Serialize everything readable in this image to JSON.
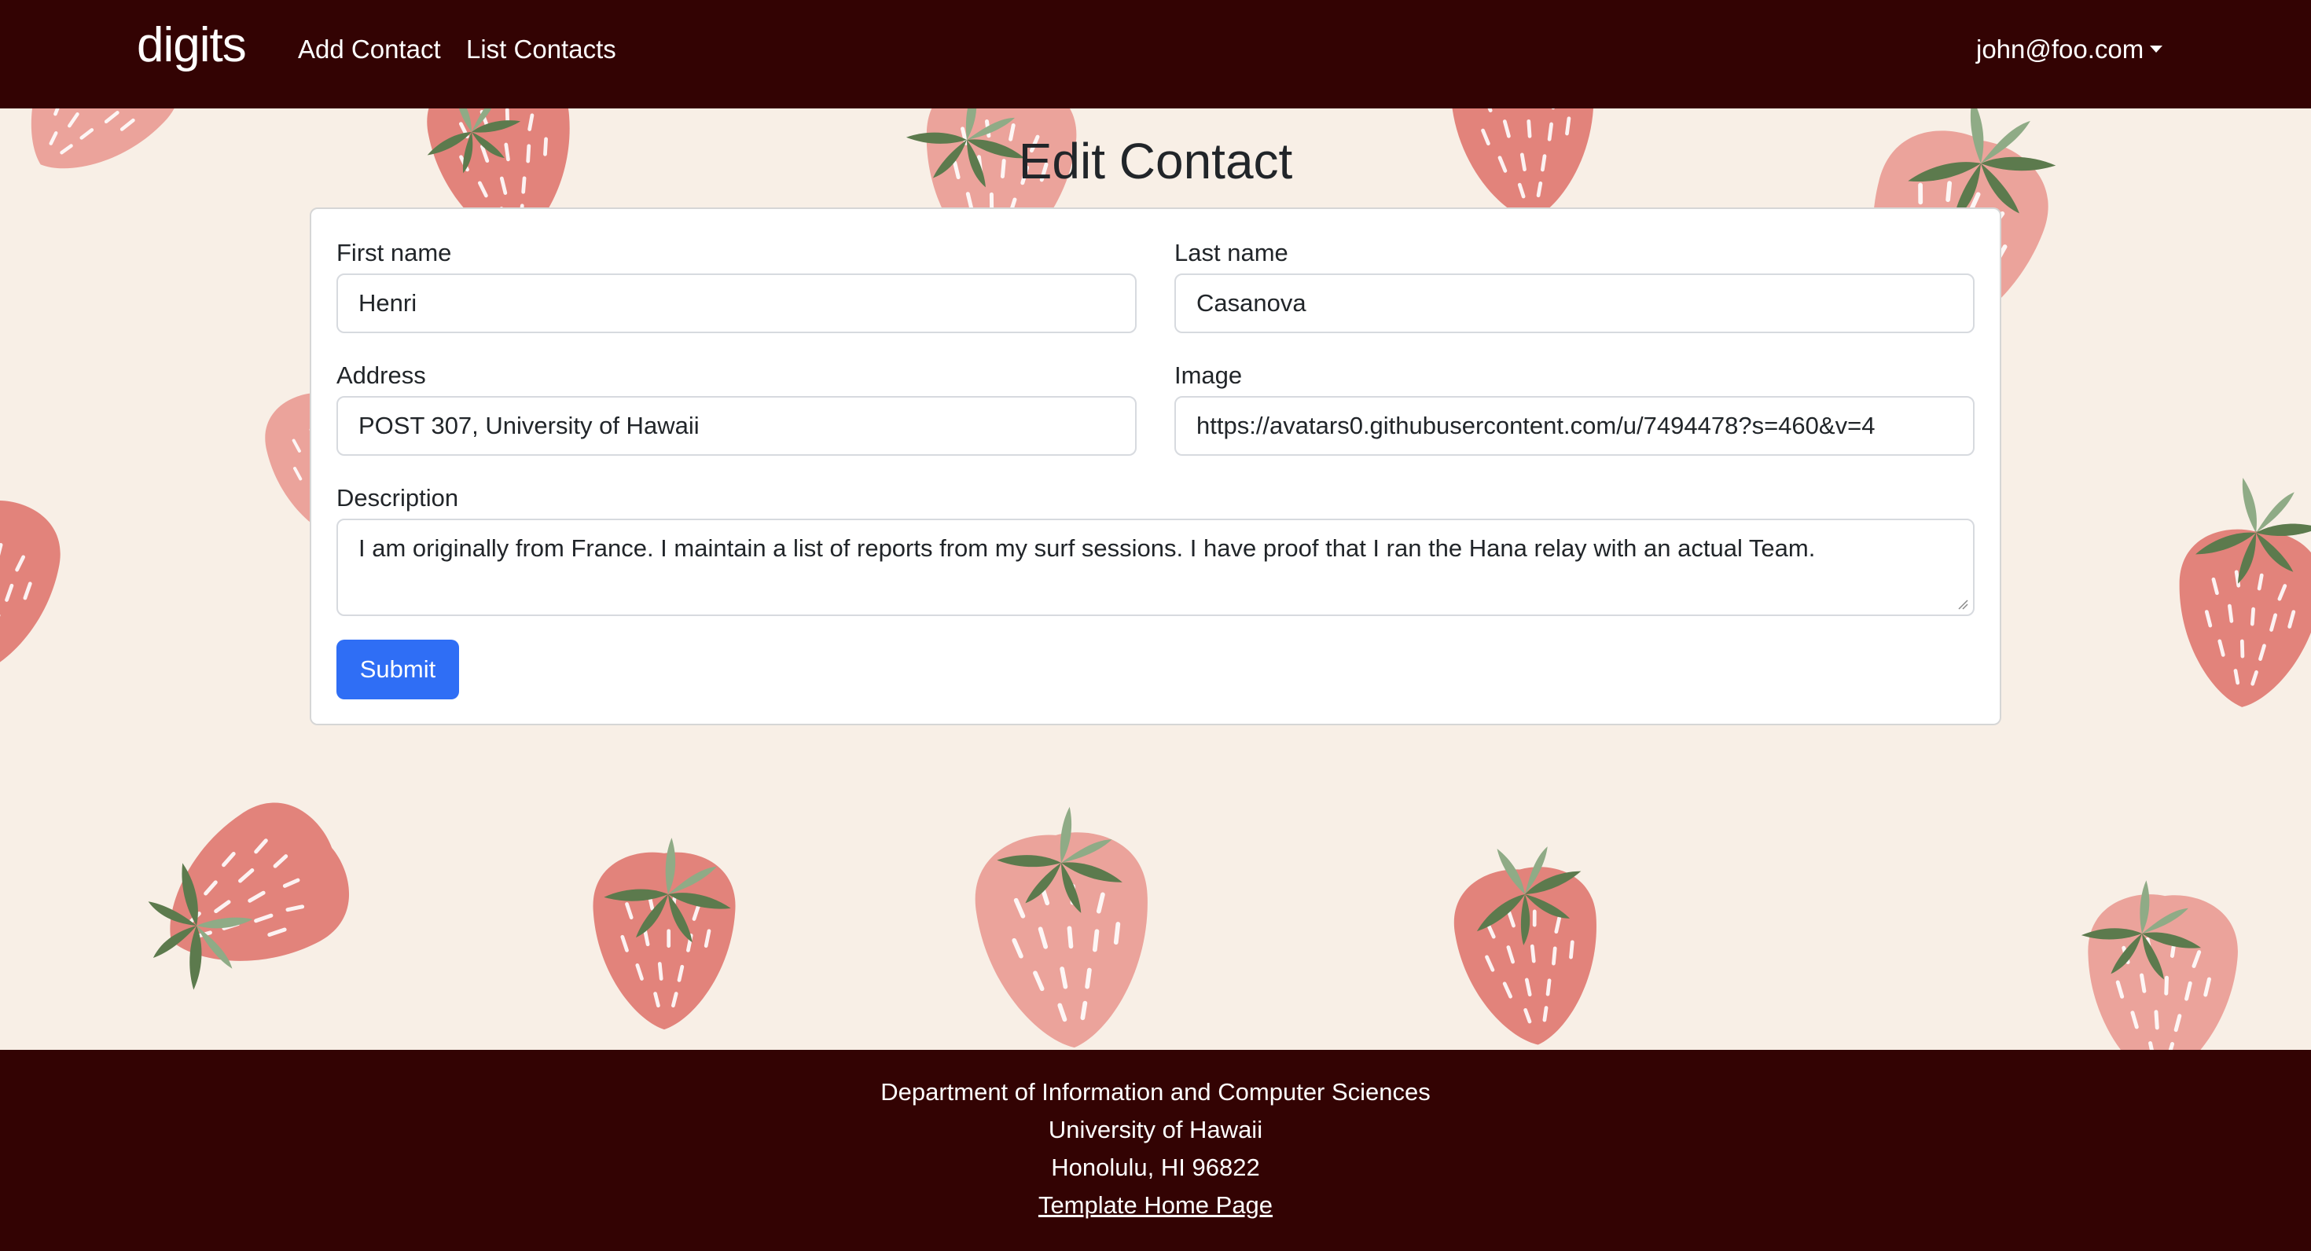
{
  "nav": {
    "brand": "digits",
    "links": [
      "Add Contact",
      "List Contacts"
    ],
    "user": "john@foo.com"
  },
  "page": {
    "title": "Edit Contact"
  },
  "form": {
    "first_name": {
      "label": "First name",
      "value": "Henri"
    },
    "last_name": {
      "label": "Last name",
      "value": "Casanova"
    },
    "address": {
      "label": "Address",
      "value": "POST 307, University of Hawaii"
    },
    "image": {
      "label": "Image",
      "value": "https://avatars0.githubusercontent.com/u/7494478?s=460&v=4"
    },
    "description": {
      "label": "Description",
      "value": "I am originally from France. I maintain a list of reports from my surf sessions. I have proof that I ran the Hana relay with an actual Team."
    },
    "submit_label": "Submit"
  },
  "footer": {
    "lines": [
      "Department of Information and Computer Sciences",
      "University of Hawaii",
      "Honolulu, HI 96822"
    ],
    "link": "Template Home Page"
  },
  "colors": {
    "navbar_bg": "#330303",
    "page_bg": "#f8efe6",
    "primary_button": "#2f6ef5",
    "strawberry_light": "#eba39b",
    "strawberry_dark": "#e2837b",
    "leaf_dark": "#5c7a4d",
    "leaf_light": "#8fab86"
  },
  "icons": {
    "user_menu": "caret-down-icon",
    "background": "strawberry-icon"
  }
}
